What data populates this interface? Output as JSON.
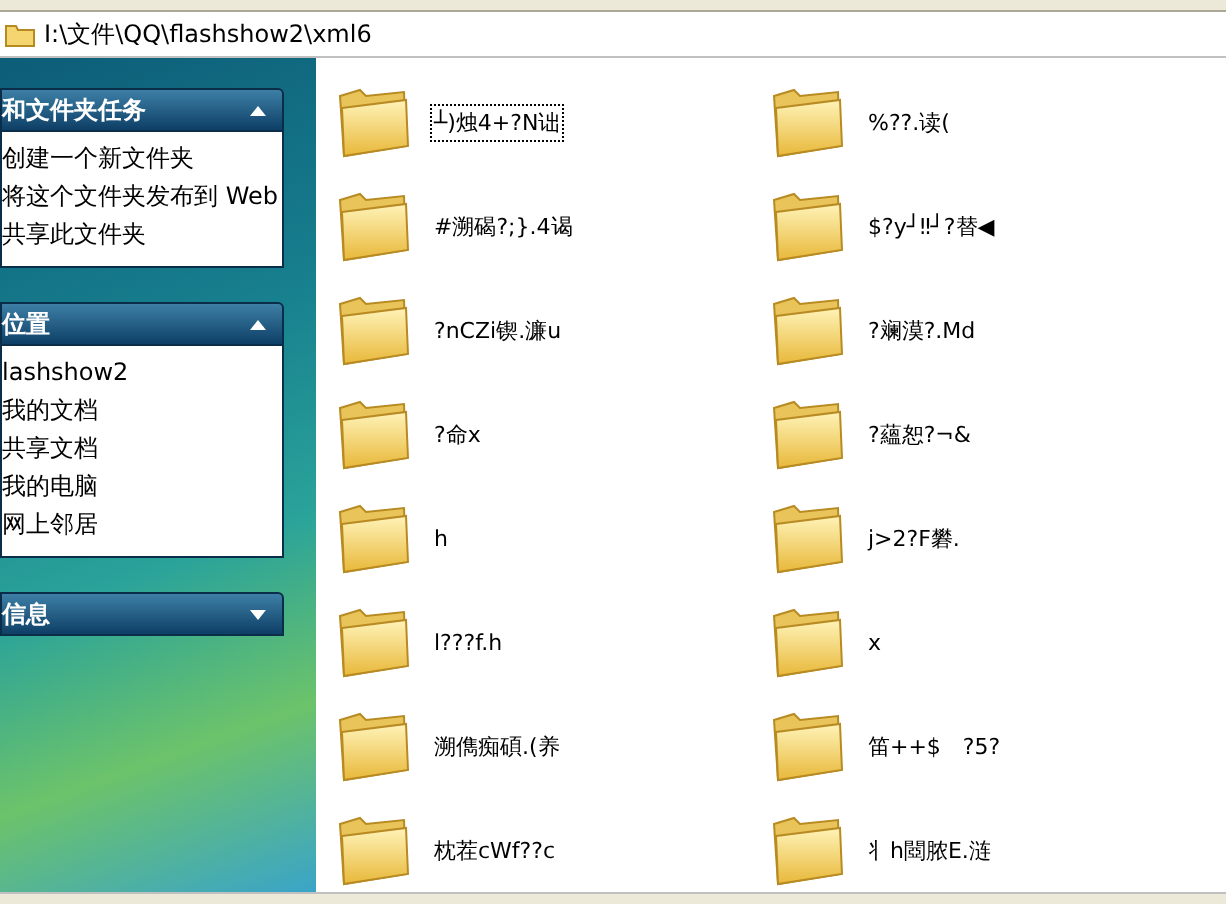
{
  "address_bar": {
    "path": "I:\\文件\\QQ\\flashshow2\\xml6"
  },
  "sidebar": {
    "panels": [
      {
        "title": "和文件夹任务",
        "expanded": true,
        "items": [
          "创建一个新文件夹",
          "将这个文件夹发布到 Web",
          "共享此文件夹"
        ]
      },
      {
        "title": "位置",
        "expanded": true,
        "items": [
          "lashshow2",
          "我的文档",
          "共享文档",
          "我的电脑",
          "网上邻居"
        ]
      },
      {
        "title": "信息",
        "expanded": false
      }
    ]
  },
  "folders": [
    {
      "name": "┴)烛4+?N诎",
      "selected": true
    },
    {
      "name": "%??.读(",
      "selected": false
    },
    {
      "name": "#溯碣?;}.4谒",
      "selected": false
    },
    {
      "name": "$?y┘‼┘?替◀",
      "selected": false
    },
    {
      "name": "?nCZi锲.濂u",
      "selected": false
    },
    {
      "name": "?斓漠?.Md",
      "selected": false
    },
    {
      "name": "?命x",
      "selected": false
    },
    {
      "name": "?蘊恕?¬&",
      "selected": false
    },
    {
      "name": "h",
      "selected": false
    },
    {
      "name": "j>2?F礬.",
      "selected": false
    },
    {
      "name": "l???f.h",
      "selected": false
    },
    {
      "name": "x",
      "selected": false
    },
    {
      "name": "溯儁痴碩.(养",
      "selected": false
    },
    {
      "name": "笛++$　?5?",
      "selected": false
    },
    {
      "name": "枕茬cWf??c",
      "selected": false
    },
    {
      "name": "丬h閸脓E.涟",
      "selected": false
    }
  ]
}
